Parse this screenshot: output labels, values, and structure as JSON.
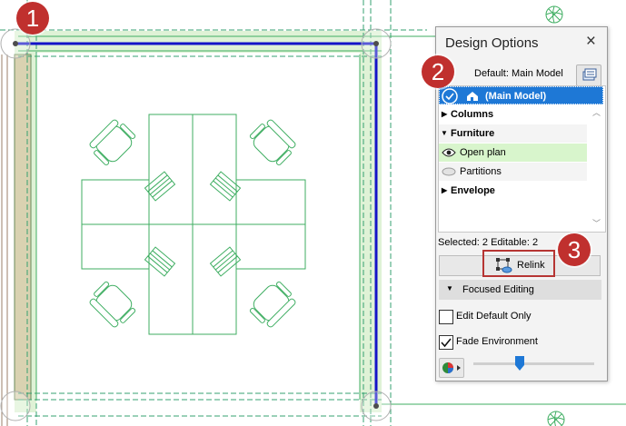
{
  "callouts": [
    "1",
    "2",
    "3"
  ],
  "panel": {
    "title": "Design Options",
    "close_icon": "×",
    "default_label": "Default: Main Model",
    "main_model": "(Main Model)",
    "groups": [
      {
        "label": "Columns",
        "expanded": false
      },
      {
        "label": "Furniture",
        "expanded": true,
        "options": [
          "Open plan",
          "Partitions"
        ]
      },
      {
        "label": "Envelope",
        "expanded": false
      }
    ],
    "status": "Selected: 2 Editable: 2",
    "relink_label": "Relink",
    "focused_label": "Focused Editing",
    "edit_default_label": "Edit Default Only",
    "edit_default_checked": false,
    "fade_label": "Fade Environment",
    "fade_checked": true,
    "fade_level": 0.38
  },
  "colors": {
    "callout": "#c0302e",
    "selection": "#1e78d6",
    "active_option": "#d8f5cc",
    "wall": "#1414c8",
    "drawing": "#3fae62"
  }
}
